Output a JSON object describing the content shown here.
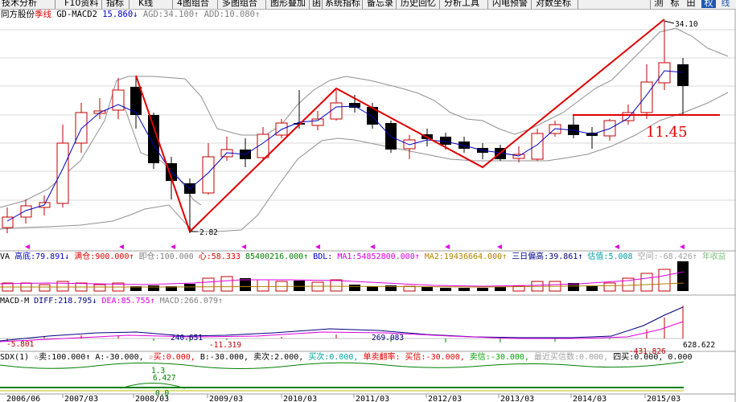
{
  "toolbar": {
    "items": [
      "技术分析",
      "F10资料",
      "指标",
      "K线",
      "4图组合",
      "多图组合",
      "图形叠加",
      "函",
      "系统指标",
      "备忘录",
      "历史回忆",
      "分析工具",
      "闪电预警",
      "对数坐标"
    ],
    "right_items": [
      "测",
      "标",
      "田",
      "权",
      "线"
    ]
  },
  "main_header": {
    "stock_name": "同方股份",
    "mode": "季线",
    "indicator_name": "GD-MACD2",
    "indicator_value": "15.860↓",
    "agd_label": "AGD:",
    "agd_value": "34.100↑",
    "add_label": "ADD:",
    "add_value": "10.080↑"
  },
  "main_annotations": {
    "high_price": "34.10",
    "low_price": "2.82",
    "support_price": "11.45"
  },
  "va_panel": {
    "name": "VA",
    "items": [
      {
        "label": "高底:",
        "value": "79.891↓",
        "color": "#0000c8"
      },
      {
        "label": "满仓:",
        "value": "900.000↑",
        "color": "#e00000"
      },
      {
        "label": "即仓:",
        "value": "100.000",
        "color": "#808080"
      },
      {
        "label": "心:",
        "value": "58.333",
        "color": "#e00000"
      },
      {
        "label": "",
        "value": "85400216.000↑",
        "color": "#008000"
      },
      {
        "label": "BDL:",
        "value": "",
        "color": "#0000c8"
      },
      {
        "label": "MA1:",
        "value": "54852800.000↑",
        "color": "#e000e0"
      },
      {
        "label": "MA2:",
        "value": "19436664.000↑",
        "color": "#b08000"
      },
      {
        "label": "三日偏高:",
        "value": "39.861↑",
        "color": "#000080"
      },
      {
        "label": "估值:",
        "value": "5.008",
        "color": "#00a0a0"
      },
      {
        "label": "空间:",
        "value": "-68.426↑",
        "color": "#a0a0a0"
      },
      {
        "label": "",
        "value": "年收益",
        "color": "#80c080"
      }
    ]
  },
  "macd_panel": {
    "name": "MACD-M",
    "diff_label": "DIFF:",
    "diff_value": "218.795↓",
    "dea_label": "DEA:",
    "dea_value": "85.755↑",
    "macd_label": "MACD:",
    "macd_value": "266.079↑",
    "annotations": [
      "-5.801",
      "240.651",
      "-11.319",
      "269.083",
      "-431.826",
      "628.622"
    ]
  },
  "sdx_panel": {
    "name": "SDX(1)",
    "items": [
      {
        "label": "☆卖:",
        "value": "100.000↑",
        "color": "#000000"
      },
      {
        "label": "A:",
        "value": "-30.000,",
        "color": "#000000"
      },
      {
        "label": "☆买:",
        "value": "0.000,",
        "color": "#e00000"
      },
      {
        "label": "B:",
        "value": "-30.000,",
        "color": "#000000"
      },
      {
        "label": "卖次:",
        "value": "2.000,",
        "color": "#000000"
      },
      {
        "label": "买次:",
        "value": "0.000,",
        "color": "#00a0a0"
      },
      {
        "label": "单卖翻率:",
        "value": "",
        "color": "#e00000"
      },
      {
        "label": "买信:",
        "value": "-30.000,",
        "color": "#e00000"
      },
      {
        "label": "卖信:",
        "value": "-30.000,",
        "color": "#00a000"
      },
      {
        "label": "最近买信数:",
        "value": "0.000,",
        "color": "#a0a0a0"
      },
      {
        "label": "四买:",
        "value": "0.000,",
        "color": "#000000"
      },
      {
        "label": "",
        "value": "0.000",
        "color": "#000000"
      }
    ],
    "annotations": [
      "1.3",
      "6.427",
      "0.0"
    ]
  },
  "time_axis": [
    "2006/06",
    "2007/03",
    "2008/03",
    "2009/03",
    "2010/03",
    "2011/03",
    "2012/03",
    "2013/03",
    "2014/03",
    "2015/03"
  ]
}
